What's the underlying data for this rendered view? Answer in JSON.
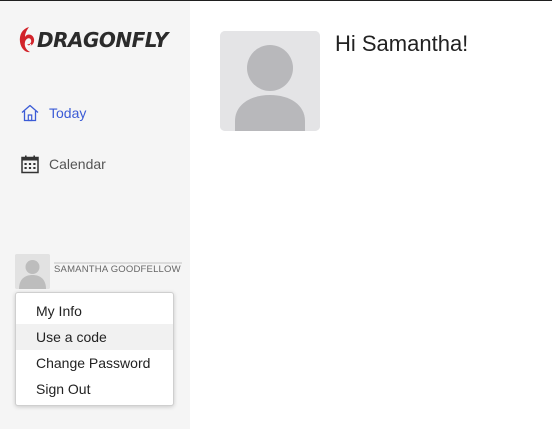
{
  "app": {
    "brand": "DRAGONFLY",
    "brand_color": "#d2232a"
  },
  "sidebar": {
    "items": [
      {
        "label": "Today",
        "icon": "home-icon",
        "active": true,
        "color": "#3b5bd6"
      },
      {
        "label": "Calendar",
        "icon": "calendar-icon",
        "active": false
      }
    ]
  },
  "user": {
    "name": "SAMANTHA GOODFELLOW",
    "avatar_icon": "user-avatar-icon"
  },
  "user_menu": {
    "items": [
      {
        "label": "My Info"
      },
      {
        "label": "Use a code",
        "hovered": true
      },
      {
        "label": "Change Password"
      },
      {
        "label": "Sign Out"
      }
    ]
  },
  "main": {
    "greeting": "Hi Samantha!",
    "photo_icon": "profile-placeholder-icon"
  }
}
